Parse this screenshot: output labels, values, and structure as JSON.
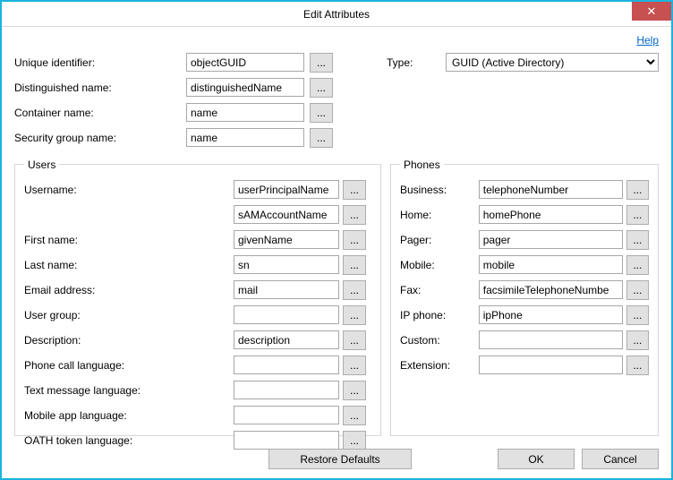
{
  "window": {
    "title": "Edit Attributes",
    "close_glyph": "✕"
  },
  "help_label": "Help",
  "browse_glyph": "...",
  "top": {
    "unique_identifier": {
      "label": "Unique identifier:",
      "value": "objectGUID"
    },
    "distinguished_name": {
      "label": "Distinguished name:",
      "value": "distinguishedName"
    },
    "container_name": {
      "label": "Container name:",
      "value": "name"
    },
    "security_group_name": {
      "label": "Security group name:",
      "value": "name"
    },
    "type": {
      "label": "Type:",
      "selected": "GUID (Active Directory)"
    }
  },
  "users": {
    "legend": "Users",
    "fields": {
      "username": {
        "label": "Username:",
        "value": "userPrincipalName"
      },
      "username_alt": {
        "label": "",
        "value": "sAMAccountName"
      },
      "first_name": {
        "label": "First name:",
        "value": "givenName"
      },
      "last_name": {
        "label": "Last name:",
        "value": "sn"
      },
      "email": {
        "label": "Email address:",
        "value": "mail"
      },
      "user_group": {
        "label": "User group:",
        "value": ""
      },
      "description": {
        "label": "Description:",
        "value": "description"
      },
      "phone_call_lang": {
        "label": "Phone call language:",
        "value": ""
      },
      "text_msg_lang": {
        "label": "Text message language:",
        "value": ""
      },
      "mobile_app_lang": {
        "label": "Mobile app language:",
        "value": ""
      },
      "oath_token_lang": {
        "label": "OATH token language:",
        "value": ""
      }
    }
  },
  "phones": {
    "legend": "Phones",
    "fields": {
      "business": {
        "label": "Business:",
        "value": "telephoneNumber"
      },
      "home": {
        "label": "Home:",
        "value": "homePhone"
      },
      "pager": {
        "label": "Pager:",
        "value": "pager"
      },
      "mobile": {
        "label": "Mobile:",
        "value": "mobile"
      },
      "fax": {
        "label": "Fax:",
        "value": "facsimileTelephoneNumbe"
      },
      "ip_phone": {
        "label": "IP phone:",
        "value": "ipPhone"
      },
      "custom": {
        "label": "Custom:",
        "value": ""
      },
      "extension": {
        "label": "Extension:",
        "value": ""
      }
    }
  },
  "footer": {
    "restore": "Restore Defaults",
    "ok": "OK",
    "cancel": "Cancel"
  }
}
